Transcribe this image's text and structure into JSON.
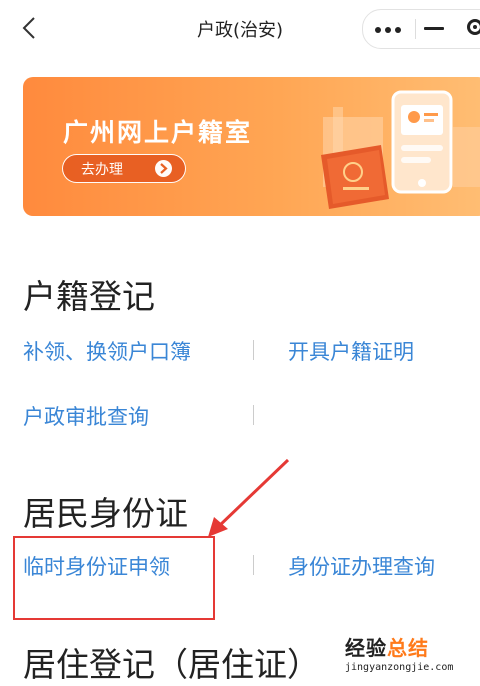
{
  "header": {
    "title": "户政(治安)"
  },
  "banner": {
    "title": "广州网上户籍室",
    "button_label": "去办理"
  },
  "sections": [
    {
      "title": "户籍登记",
      "links": [
        "补领、换领户口簿",
        "开具户籍证明",
        "户政审批查询"
      ]
    },
    {
      "title": "居民身份证",
      "links": [
        "临时身份证申领",
        "身份证办理查询"
      ]
    },
    {
      "title": "居住登记（居住证）",
      "links": []
    }
  ],
  "watermark": {
    "main_a": "经验",
    "main_b": "总结",
    "url": "jingyanzongjie.com"
  },
  "colors": {
    "link": "#3a86d6",
    "banner_start": "#ff8a3d",
    "banner_end": "#ffbe74",
    "annotation": "#e53935"
  }
}
